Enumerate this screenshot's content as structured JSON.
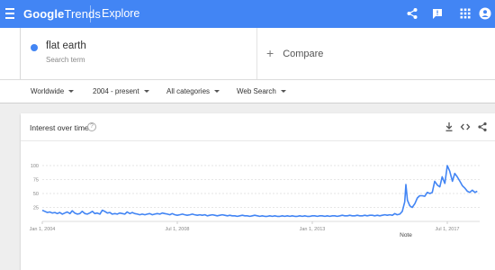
{
  "app": {
    "logo_google": "Google",
    "logo_trends": "Trends",
    "section": "Explore",
    "icons": [
      "menu-icon",
      "share-icon",
      "feedback-icon",
      "apps-icon",
      "account-icon"
    ]
  },
  "search": {
    "term": "flat earth",
    "term_type": "Search term",
    "term_color": "#4285f4",
    "compare_icon": "plus-icon",
    "compare_label": "Compare"
  },
  "filters": [
    {
      "label": "Worldwide"
    },
    {
      "label": "2004 - present"
    },
    {
      "label": "All categories"
    },
    {
      "label": "Web Search"
    }
  ],
  "card": {
    "title": "Interest over time",
    "help": "?",
    "icons": [
      "download-icon",
      "embed-icon",
      "share-icon"
    ]
  },
  "chart_data": {
    "type": "line",
    "title": "Interest over time",
    "series": [
      {
        "color": "#4285f4",
        "values": [
          [
            2004.0,
            20
          ],
          [
            2004.08,
            18
          ],
          [
            2004.17,
            16
          ],
          [
            2004.25,
            17
          ],
          [
            2004.33,
            15
          ],
          [
            2004.42,
            16
          ],
          [
            2004.5,
            14
          ],
          [
            2004.58,
            16
          ],
          [
            2004.67,
            13
          ],
          [
            2004.75,
            15
          ],
          [
            2004.83,
            17
          ],
          [
            2004.92,
            14
          ],
          [
            2005.0,
            19
          ],
          [
            2005.08,
            15
          ],
          [
            2005.17,
            13
          ],
          [
            2005.25,
            14
          ],
          [
            2005.33,
            18
          ],
          [
            2005.42,
            14
          ],
          [
            2005.5,
            13
          ],
          [
            2005.58,
            15
          ],
          [
            2005.67,
            18
          ],
          [
            2005.75,
            14
          ],
          [
            2005.83,
            15
          ],
          [
            2005.92,
            13
          ],
          [
            2006.0,
            20
          ],
          [
            2006.08,
            18
          ],
          [
            2006.17,
            15
          ],
          [
            2006.25,
            16
          ],
          [
            2006.33,
            13
          ],
          [
            2006.42,
            14
          ],
          [
            2006.5,
            13
          ],
          [
            2006.58,
            15
          ],
          [
            2006.67,
            14
          ],
          [
            2006.75,
            13
          ],
          [
            2006.83,
            17
          ],
          [
            2006.92,
            14
          ],
          [
            2007.0,
            16
          ],
          [
            2007.08,
            14
          ],
          [
            2007.17,
            13
          ],
          [
            2007.25,
            12
          ],
          [
            2007.33,
            13
          ],
          [
            2007.42,
            12
          ],
          [
            2007.5,
            13
          ],
          [
            2007.58,
            14
          ],
          [
            2007.67,
            12
          ],
          [
            2007.75,
            13
          ],
          [
            2007.83,
            14
          ],
          [
            2007.92,
            13
          ],
          [
            2008.0,
            15
          ],
          [
            2008.08,
            14
          ],
          [
            2008.17,
            13
          ],
          [
            2008.25,
            12
          ],
          [
            2008.33,
            14
          ],
          [
            2008.42,
            12
          ],
          [
            2008.5,
            11
          ],
          [
            2008.58,
            12
          ],
          [
            2008.67,
            13
          ],
          [
            2008.75,
            12
          ],
          [
            2008.83,
            11
          ],
          [
            2008.92,
            12
          ],
          [
            2009.0,
            13
          ],
          [
            2009.08,
            12
          ],
          [
            2009.17,
            11
          ],
          [
            2009.25,
            12
          ],
          [
            2009.33,
            11
          ],
          [
            2009.42,
            12
          ],
          [
            2009.5,
            10
          ],
          [
            2009.58,
            11
          ],
          [
            2009.67,
            12
          ],
          [
            2009.75,
            11
          ],
          [
            2009.83,
            10
          ],
          [
            2009.92,
            11
          ],
          [
            2010.0,
            12
          ],
          [
            2010.08,
            11
          ],
          [
            2010.17,
            10
          ],
          [
            2010.25,
            11
          ],
          [
            2010.33,
            10
          ],
          [
            2010.42,
            10
          ],
          [
            2010.5,
            9
          ],
          [
            2010.58,
            10
          ],
          [
            2010.67,
            11
          ],
          [
            2010.75,
            10
          ],
          [
            2010.83,
            10
          ],
          [
            2010.92,
            9
          ],
          [
            2011.0,
            10
          ],
          [
            2011.08,
            11
          ],
          [
            2011.17,
            10
          ],
          [
            2011.25,
            9
          ],
          [
            2011.33,
            10
          ],
          [
            2011.42,
            9
          ],
          [
            2011.5,
            9
          ],
          [
            2011.58,
            10
          ],
          [
            2011.67,
            9
          ],
          [
            2011.75,
            10
          ],
          [
            2011.83,
            9
          ],
          [
            2011.92,
            9
          ],
          [
            2012.0,
            10
          ],
          [
            2012.08,
            9
          ],
          [
            2012.17,
            10
          ],
          [
            2012.25,
            9
          ],
          [
            2012.33,
            10
          ],
          [
            2012.42,
            9
          ],
          [
            2012.5,
            9
          ],
          [
            2012.58,
            10
          ],
          [
            2012.67,
            9
          ],
          [
            2012.75,
            10
          ],
          [
            2012.83,
            9
          ],
          [
            2012.92,
            9
          ],
          [
            2013.0,
            10
          ],
          [
            2013.08,
            10
          ],
          [
            2013.17,
            9
          ],
          [
            2013.25,
            10
          ],
          [
            2013.33,
            10
          ],
          [
            2013.42,
            9
          ],
          [
            2013.5,
            10
          ],
          [
            2013.58,
            9
          ],
          [
            2013.67,
            10
          ],
          [
            2013.75,
            10
          ],
          [
            2013.83,
            9
          ],
          [
            2013.92,
            10
          ],
          [
            2014.0,
            11
          ],
          [
            2014.08,
            10
          ],
          [
            2014.17,
            10
          ],
          [
            2014.25,
            11
          ],
          [
            2014.33,
            10
          ],
          [
            2014.42,
            10
          ],
          [
            2014.5,
            11
          ],
          [
            2014.58,
            10
          ],
          [
            2014.67,
            10
          ],
          [
            2014.75,
            11
          ],
          [
            2014.83,
            10
          ],
          [
            2014.92,
            11
          ],
          [
            2015.0,
            11
          ],
          [
            2015.08,
            10
          ],
          [
            2015.17,
            11
          ],
          [
            2015.25,
            10
          ],
          [
            2015.33,
            11
          ],
          [
            2015.42,
            12
          ],
          [
            2015.5,
            11
          ],
          [
            2015.58,
            12
          ],
          [
            2015.67,
            11
          ],
          [
            2015.75,
            14
          ],
          [
            2015.83,
            12
          ],
          [
            2015.92,
            13
          ],
          [
            2016.0,
            18
          ],
          [
            2016.08,
            35
          ],
          [
            2016.12,
            66
          ],
          [
            2016.17,
            38
          ],
          [
            2016.25,
            28
          ],
          [
            2016.33,
            25
          ],
          [
            2016.42,
            32
          ],
          [
            2016.5,
            42
          ],
          [
            2016.58,
            46
          ],
          [
            2016.67,
            46
          ],
          [
            2016.75,
            45
          ],
          [
            2016.83,
            52
          ],
          [
            2016.92,
            50
          ],
          [
            2017.0,
            52
          ],
          [
            2017.08,
            72
          ],
          [
            2017.17,
            65
          ],
          [
            2017.25,
            62
          ],
          [
            2017.33,
            80
          ],
          [
            2017.42,
            68
          ],
          [
            2017.5,
            100
          ],
          [
            2017.58,
            90
          ],
          [
            2017.67,
            72
          ],
          [
            2017.75,
            86
          ],
          [
            2017.83,
            80
          ],
          [
            2017.92,
            72
          ],
          [
            2018.0,
            64
          ],
          [
            2018.08,
            60
          ],
          [
            2018.17,
            54
          ],
          [
            2018.25,
            52
          ],
          [
            2018.33,
            56
          ],
          [
            2018.42,
            52
          ],
          [
            2018.5,
            54
          ]
        ]
      }
    ],
    "x_ticks": [
      {
        "value": 2004.0,
        "label": "Jan 1, 2004"
      },
      {
        "value": 2008.5,
        "label": "Jul 1, 2008"
      },
      {
        "value": 2013.0,
        "label": "Jan 1, 2013"
      },
      {
        "value": 2017.5,
        "label": "Jul 1, 2017"
      }
    ],
    "y_ticks": [
      25,
      50,
      75,
      100
    ],
    "xlim": [
      2004.0,
      2018.58
    ],
    "ylim": [
      0,
      100
    ],
    "grid": true,
    "annotations": [
      {
        "x": 2016.12,
        "label": "Note"
      }
    ]
  }
}
